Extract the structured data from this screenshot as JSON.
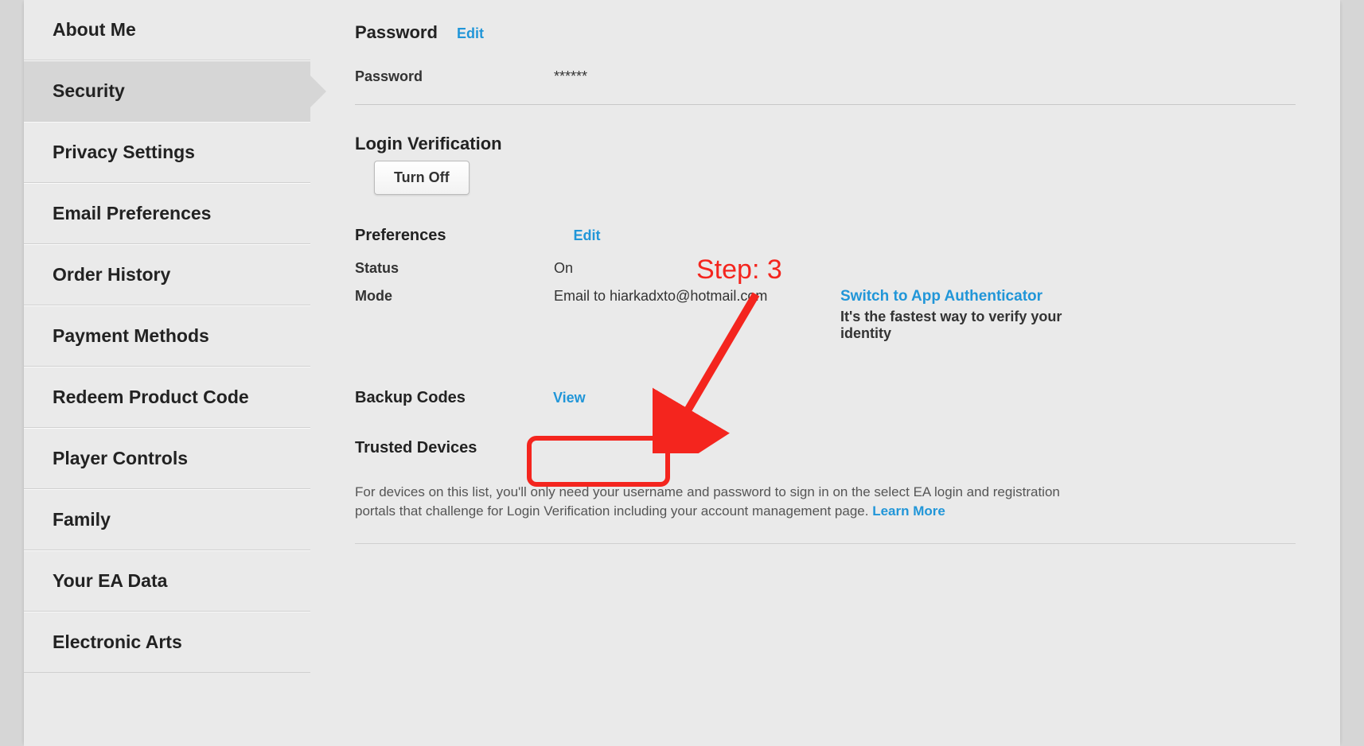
{
  "sidebar": {
    "items": [
      {
        "label": "About Me"
      },
      {
        "label": "Security"
      },
      {
        "label": "Privacy Settings"
      },
      {
        "label": "Email Preferences"
      },
      {
        "label": "Order History"
      },
      {
        "label": "Payment Methods"
      },
      {
        "label": "Redeem Product Code"
      },
      {
        "label": "Player Controls"
      },
      {
        "label": "Family"
      },
      {
        "label": "Your EA Data"
      },
      {
        "label": "Electronic Arts"
      }
    ]
  },
  "password": {
    "title": "Password",
    "edit": "Edit",
    "label": "Password",
    "value": "******"
  },
  "login_verification": {
    "title": "Login Verification",
    "turn_off": "Turn Off",
    "preferences_title": "Preferences",
    "preferences_edit": "Edit",
    "status_label": "Status",
    "status_value": "On",
    "mode_label": "Mode",
    "mode_value": "Email to hiarkadxto@hotmail.com",
    "switch_link": "Switch to App Authenticator",
    "switch_desc": "It's the fastest way to verify your identity"
  },
  "backup_codes": {
    "title": "Backup Codes",
    "view": "View"
  },
  "trusted": {
    "title": "Trusted Devices",
    "desc": "For devices on this list, you'll only need your username and password to sign in on the select EA login and registration portals that challenge for Login Verification including your account management page.  ",
    "learn_more": "Learn More"
  },
  "annotation": {
    "label": "Step: 3"
  }
}
